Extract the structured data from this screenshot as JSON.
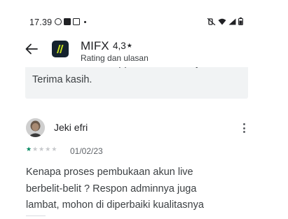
{
  "status_bar": {
    "time": "17.39"
  },
  "header": {
    "app_name": "MIFX",
    "rating": "4,3",
    "rating_star": "★",
    "subtitle": "Rating dan ulasan"
  },
  "previous_reply": {
    "lines": [
      "melalui email ke support@mifx.com ya.",
      "Terima kasih."
    ]
  },
  "review": {
    "reviewer": "Jeki efri",
    "rating": 1,
    "max_rating": 5,
    "date": "01/02/23",
    "body_lines": [
      "Kenapa proses pembukaan akun live",
      "berbelit-belit ? Respon adminnya juga",
      "lambat, mohon di diperbaiki kualitasnya"
    ]
  },
  "colors": {
    "star_filled": "#01875f",
    "star_empty": "#c6c8cb",
    "reply_background": "#f1f3f4",
    "logo_background": "#14222e",
    "logo_stripe": "#c6e01d"
  }
}
